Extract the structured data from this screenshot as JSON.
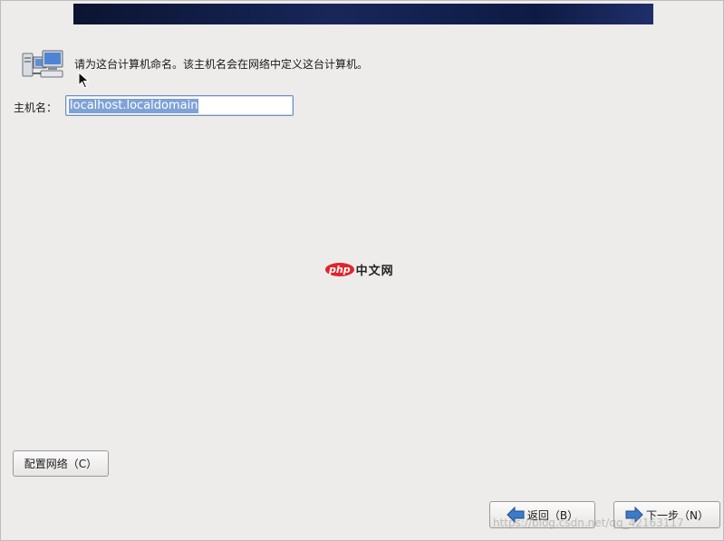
{
  "intro_text": "请为这台计算机命名。该主机名会在网络中定义这台计算机。",
  "hostname": {
    "label": "主机名：",
    "value": "localhost.localdomain"
  },
  "buttons": {
    "configure_network": "配置网络（C）",
    "back": "返回（B）",
    "next": "下一步（N）"
  },
  "icons": {
    "header": "network-computers-icon",
    "back": "arrow-left-icon",
    "next": "arrow-right-icon"
  },
  "logo": {
    "mark": "php",
    "text": "中文网"
  },
  "watermark": "https://blog.csdn.net/qq_42163117",
  "colors": {
    "banner": "#16224f",
    "selection": "#7fa2d7",
    "field_border": "#6f8fc2",
    "background": "#edeceb"
  }
}
